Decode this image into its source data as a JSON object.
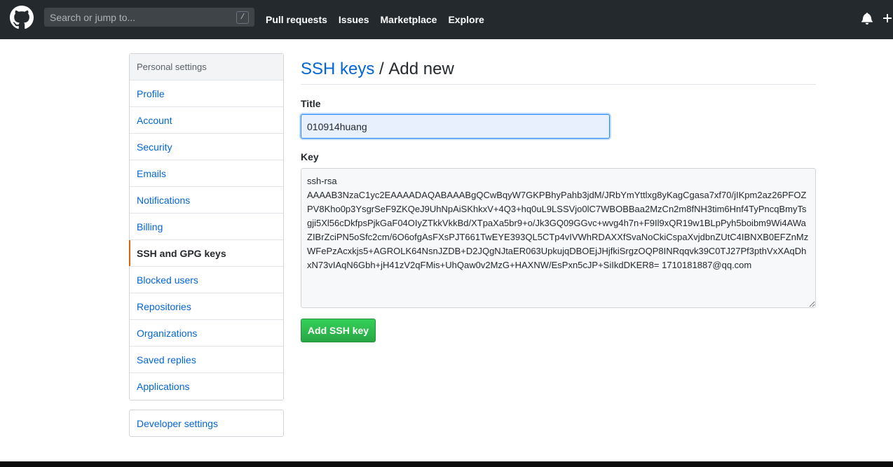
{
  "header": {
    "search_placeholder": "Search or jump to...",
    "search_shortcut": "/",
    "nav": [
      "Pull requests",
      "Issues",
      "Marketplace",
      "Explore"
    ]
  },
  "sidebar": {
    "header": "Personal settings",
    "items": [
      {
        "label": "Profile",
        "selected": false
      },
      {
        "label": "Account",
        "selected": false
      },
      {
        "label": "Security",
        "selected": false
      },
      {
        "label": "Emails",
        "selected": false
      },
      {
        "label": "Notifications",
        "selected": false
      },
      {
        "label": "Billing",
        "selected": false
      },
      {
        "label": "SSH and GPG keys",
        "selected": true
      },
      {
        "label": "Blocked users",
        "selected": false
      },
      {
        "label": "Repositories",
        "selected": false
      },
      {
        "label": "Organizations",
        "selected": false
      },
      {
        "label": "Saved replies",
        "selected": false
      },
      {
        "label": "Applications",
        "selected": false
      }
    ],
    "developer_settings": "Developer settings"
  },
  "main": {
    "breadcrumb_link": "SSH keys",
    "breadcrumb_sep": " / ",
    "breadcrumb_current": "Add new",
    "title_label": "Title",
    "title_value": "010914huang",
    "key_label": "Key",
    "key_value": "ssh-rsa\nAAAAB3NzaC1yc2EAAAADAQABAAABgQCwBqyW7GKPBhyPahb3jdM/JRbYmYttlxg8yKagCgasa7xf70/jIKpm2az26PFOZPV8Kho0p3YsgrSeF9ZKQeJ9UhNpAiSKhkxV+4Q3+hq0uL9LSSVjo0lC7WBOBBaa2MzCn2m8fNH3tim6Hnf4TyPncqBmyTsgji5Xl56cDkfpsPjkGaF04OIyZTkkVkkBd/XTpaXa5br9+o/Jk3GQ09GGvc+wvg4h7n+F9Il9xQR19w1BLpPyh5boibm9Wi4AWaZIBrZciPN5oSfc2cm/6O6ofgAsFXsPJT661TwEYE393QL5CTp4vIVWhRDAXXfSvaNoCkiCspaXvjdbnZUtC4IBNXB0EFZnMzWFePzAcxkjs5+AGROLK64NsnJZDB+D2JQgNJtaER063UpkujqDBOEjJHjfkiSrgzOQP8INRqqvk39C0TJ27Pf3pthVxXAqDhxN73vIAqN6Gbh+jH41zV2qFMis+UhQaw0v2MzG+HAXNW/EsPxn5cJP+SiIkdDKER8= 1710181887@qq.com",
    "add_button": "Add SSH key"
  },
  "colors": {
    "header_bg": "#24292e",
    "link": "#0366d6",
    "selected_indicator": "#e36209",
    "button_green": "#28a745"
  },
  "icons": [
    "github-mark-icon",
    "bell-icon",
    "plus-icon"
  ]
}
